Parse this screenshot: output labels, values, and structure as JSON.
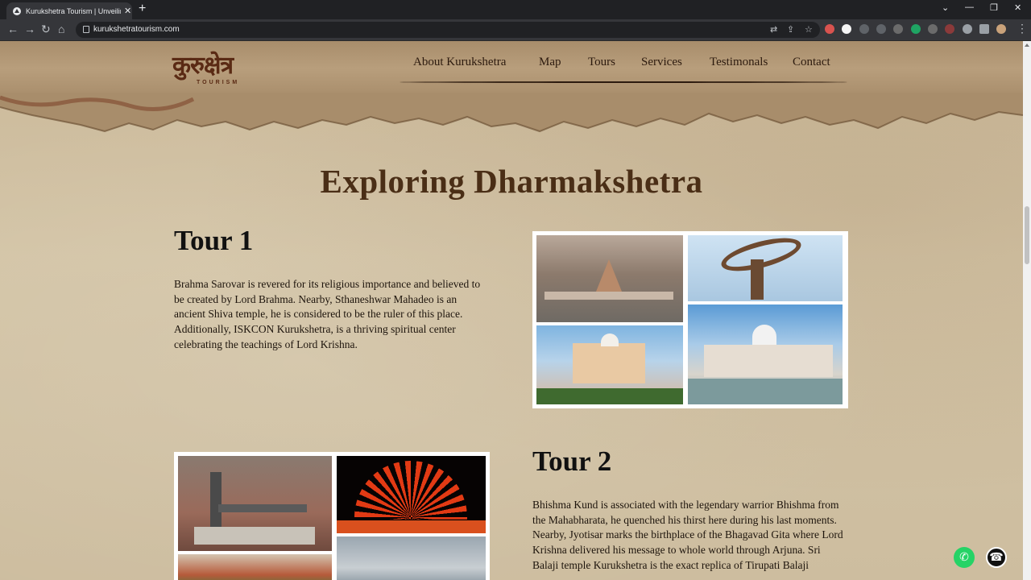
{
  "browser": {
    "tab_title": "Kurukshetra Tourism | Unveiling t",
    "tab_close": "✕",
    "new_tab": "+",
    "url": "kurukshetratourism.com",
    "window_controls": [
      "⌄",
      "—",
      "❐",
      "✕"
    ]
  },
  "site": {
    "logo_text": "कुरुक्षेत्र",
    "logo_subtext": "TOURISM",
    "nav": [
      "About Kurukshetra",
      "Map",
      "Tours",
      "Services",
      "Testimonals",
      "Contact"
    ]
  },
  "main": {
    "title": "Exploring Dharmakshetra",
    "tours": [
      {
        "heading": "Tour 1",
        "text": "Brahma Sarovar is revered for its religious importance and believed to be created by Lord Brahma. Nearby, Sthaneshwar Mahadeo is an ancient Shiva temple, he is considered to be the ruler of this place. Additionally, ISKCON Kurukshetra, is a thriving spiritual center celebrating the teachings of Lord Krishna."
      },
      {
        "heading": "Tour 2",
        "text": "Bhishma Kund is associated with the legendary warrior Bhishma from the Mahabharata, he quenched his thirst here during his last moments. Nearby, Jyotisar marks the birthplace of the Bhagavad Gita where Lord Krishna delivered his message to whole world through Arjuna. Sri Balaji temple Kurukshetra is the exact replica of Tirupati Balaji"
      }
    ]
  },
  "icons": {
    "whatsapp": "whatsapp-icon",
    "call": "phone-call-icon"
  },
  "colors": {
    "title": "#4a2e16",
    "logo": "#5a2a14",
    "whatsapp": "#25d366"
  }
}
